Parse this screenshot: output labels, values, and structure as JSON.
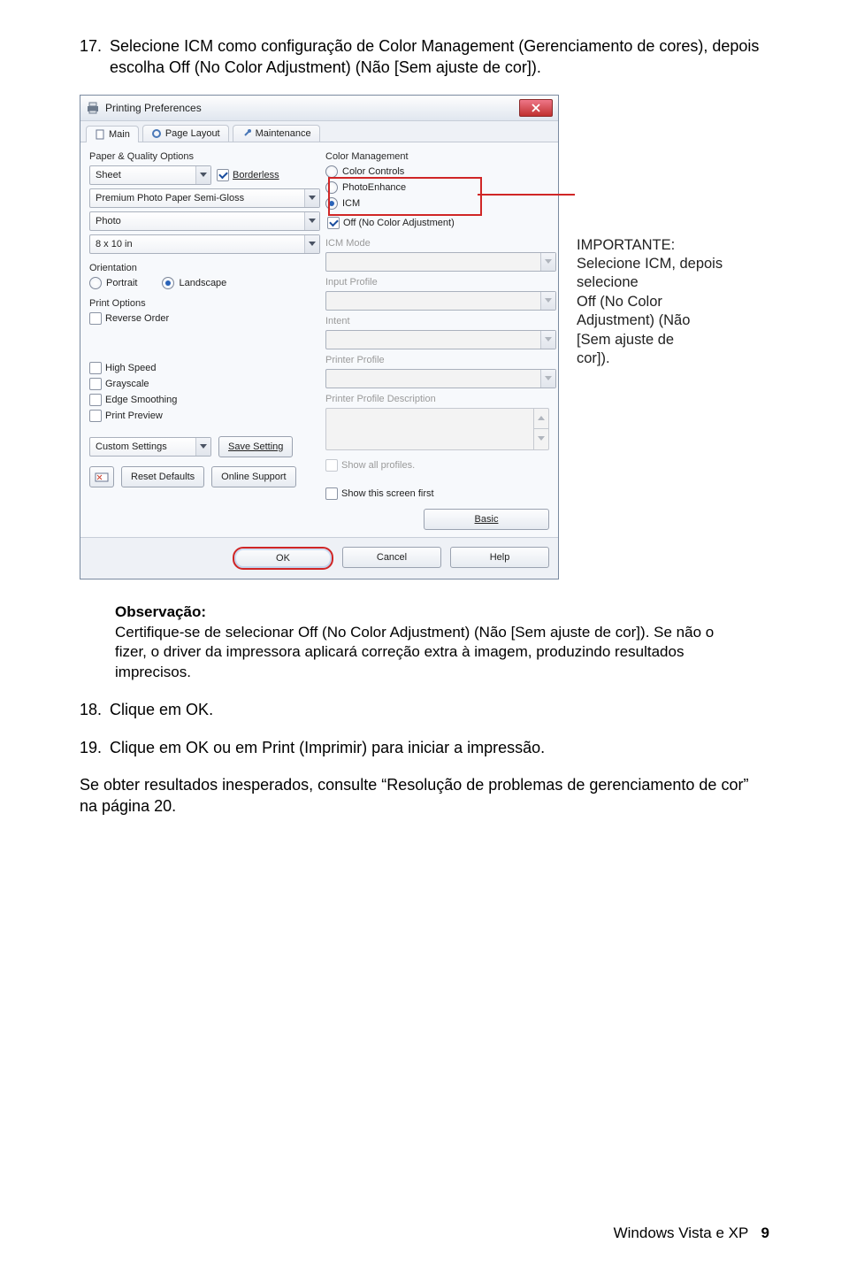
{
  "step17": {
    "num": "17.",
    "text_before": "Selecione ",
    "icm": "ICM",
    "text_mid1": " como configuração de ",
    "cm": "Color Management",
    "text_mid2": " (Gerenciamento de cores), depois escolha ",
    "off": "Off (No Color Adjustment)",
    "text_after": " (Não [Sem ajuste de cor])."
  },
  "dialog": {
    "title": "Printing Preferences",
    "tabs": {
      "main": "Main",
      "page": "Page Layout",
      "maint": "Maintenance"
    },
    "left": {
      "group": "Paper & Quality Options",
      "sheet": "Sheet",
      "borderless": "Borderless",
      "paper": "Premium Photo Paper Semi-Gloss",
      "quality": "Photo",
      "size": "8 x 10 in",
      "orientation_label": "Orientation",
      "portrait": "Portrait",
      "landscape": "Landscape",
      "print_options": "Print Options",
      "reverse": "Reverse Order",
      "highspeed": "High Speed",
      "grayscale": "Grayscale",
      "edge": "Edge Smoothing",
      "preview": "Print Preview",
      "custom": "Custom Settings",
      "save": "Save Setting",
      "reset": "Reset Defaults",
      "online": "Online Support"
    },
    "right": {
      "group": "Color Management",
      "controls": "Color Controls",
      "photoenh": "PhotoEnhance",
      "icm": "ICM",
      "off": "Off (No Color Adjustment)",
      "icm_mode": "ICM Mode",
      "input": "Input Profile",
      "intent": "Intent",
      "printer_profile": "Printer Profile",
      "ppd": "Printer Profile Description",
      "showall": "Show all profiles.",
      "showfirst": "Show this screen first",
      "basic": "Basic"
    },
    "buttons": {
      "ok": "OK",
      "cancel": "Cancel",
      "help": "Help"
    }
  },
  "callout": {
    "head": "IMPORTANTE:",
    "line1_a": "Selecione ",
    "line1_b": "ICM",
    "line1_c": ", depois selecione",
    "line2_a": "Off (No Color",
    "line2_b": "Adjustment)",
    "line2_c": " (Não [Sem ajuste de cor]).",
    "line2_c1": " (Não",
    "line2_c2": "[Sem ajuste de",
    "line2_c3": "cor])."
  },
  "note": {
    "label": "Observação:",
    "t1": "Certifique-se de selecionar ",
    "b1": "Off (No Color Adjustment)",
    "t2": " (Não [Sem ajuste de cor]). Se não o fizer, o driver da impressora aplicará correção extra à imagem, produzindo resultados imprecisos."
  },
  "step18": {
    "num": "18.",
    "a": "Clique em ",
    "b": "OK",
    "c": "."
  },
  "step19": {
    "num": "19.",
    "a": "Clique em ",
    "b": "OK",
    "c": " ou em ",
    "d": "Print",
    "e": " (Imprimir) para iniciar a impressão."
  },
  "para": "Se obter resultados inesperados, consulte “Resolução de problemas de gerenciamento de cor” na página 20.",
  "footer": {
    "section": "Windows Vista e XP",
    "page": "9"
  }
}
